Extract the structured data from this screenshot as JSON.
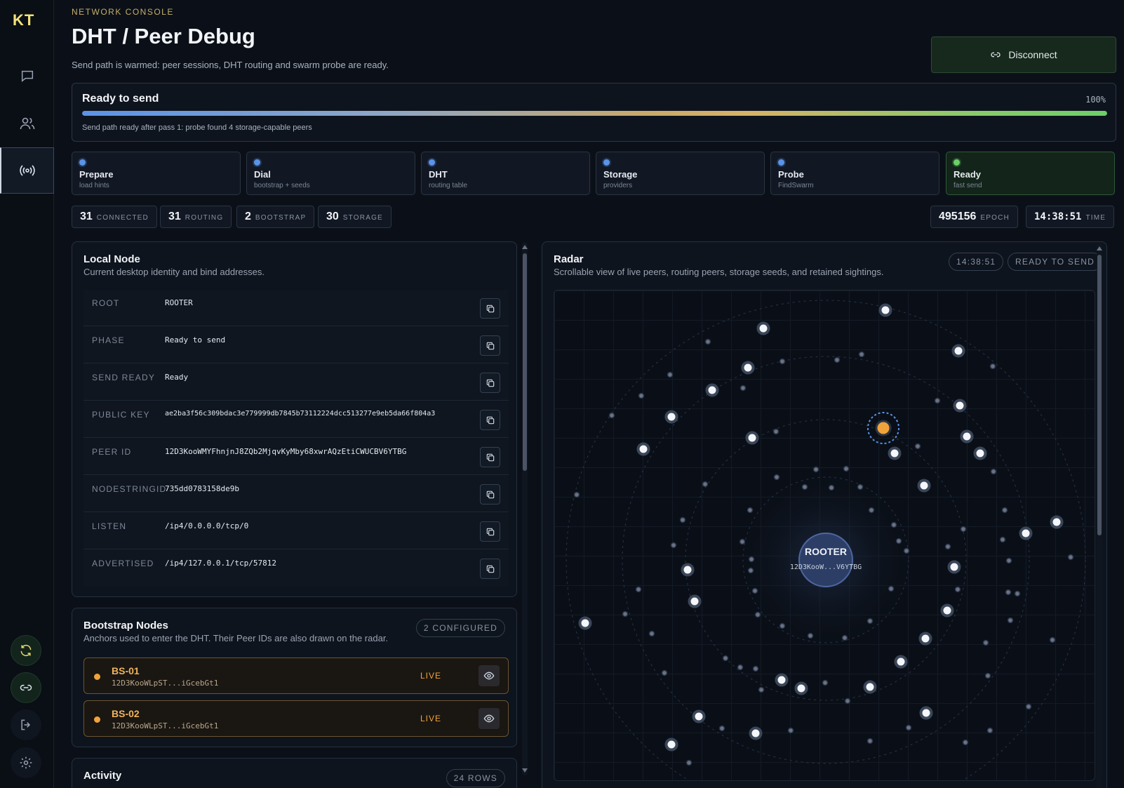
{
  "app": {
    "logo": "KT"
  },
  "header": {
    "eyebrow": "NETWORK CONSOLE",
    "title": "DHT / Peer Debug",
    "subtitle": "Send path is warmed: peer sessions, DHT routing and swarm probe are ready.",
    "disconnect_label": "Disconnect"
  },
  "progress": {
    "title": "Ready to send",
    "percent_label": "100%",
    "percent": 100,
    "note": "Send path ready after pass 1: probe found 4 storage-capable peers"
  },
  "steps": [
    {
      "name": "Prepare",
      "sub": "load hints"
    },
    {
      "name": "Dial",
      "sub": "bootstrap + seeds"
    },
    {
      "name": "DHT",
      "sub": "routing table"
    },
    {
      "name": "Storage",
      "sub": "providers"
    },
    {
      "name": "Probe",
      "sub": "FindSwarm"
    },
    {
      "name": "Ready",
      "sub": "fast send"
    }
  ],
  "stats": [
    {
      "value": "31",
      "label": "CONNECTED"
    },
    {
      "value": "31",
      "label": "ROUTING"
    },
    {
      "value": "2",
      "label": "BOOTSTRAP"
    },
    {
      "value": "30",
      "label": "STORAGE"
    }
  ],
  "meta": {
    "epoch_value": "495156",
    "epoch_label": "EPOCH",
    "time_value": "14:38:51",
    "time_label": "TIME"
  },
  "local_node": {
    "title": "Local Node",
    "desc": "Current desktop identity and bind addresses.",
    "rows": [
      {
        "key": "ROOT",
        "value": "ROOTER"
      },
      {
        "key": "PHASE",
        "value": "Ready to send"
      },
      {
        "key": "SEND READY",
        "value": "Ready"
      },
      {
        "key": "PUBLIC KEY",
        "value": "ae2ba3f56c309bdac3e779999db7845b73112224dcc513277e9eb5da66f804a3"
      },
      {
        "key": "PEER ID",
        "value": "12D3KooWMYFhnjnJ8ZQb2MjqvKyMby68xwrAQzEtiCWUCBV6YTBG"
      },
      {
        "key": "NODESTRINGID",
        "value": "735dd0783158de9b"
      },
      {
        "key": "LISTEN",
        "value": "/ip4/0.0.0.0/tcp/0"
      },
      {
        "key": "ADVERTISED",
        "value": "/ip4/127.0.0.1/tcp/57812"
      }
    ]
  },
  "bootstrap": {
    "title": "Bootstrap Nodes",
    "desc": "Anchors used to enter the DHT. Their Peer IDs are also drawn on the radar.",
    "badge": "2 CONFIGURED",
    "nodes": [
      {
        "name": "BS-01",
        "id": "12D3KooWLpST...iGcebGt1",
        "status": "LIVE"
      },
      {
        "name": "BS-02",
        "id": "12D3KooWLpST...iGcebGt1",
        "status": "LIVE"
      }
    ]
  },
  "activity": {
    "title": "Activity",
    "badge": "24 ROWS"
  },
  "radar": {
    "title": "Radar",
    "desc": "Scrollable view of live peers, routing peers, storage seeds, and retained sightings.",
    "time_badge": "14:38:51",
    "status_badge": "READY TO SEND",
    "center_label": "ROOTER",
    "center_id": "12D3KooW...V6YTBG"
  },
  "icons": {
    "chat": "chat-icon",
    "users": "users-icon",
    "radar": "radar-icon",
    "refresh": "refresh-icon",
    "link": "link-icon",
    "logout": "logout-icon",
    "settings": "gear-icon",
    "copy": "copy-icon",
    "eye": "eye-icon"
  },
  "colors": {
    "accent_green": "#6ccf6a",
    "accent_blue": "#5b93e8",
    "accent_orange": "#f0a33a",
    "logo": "#f1e27a"
  }
}
